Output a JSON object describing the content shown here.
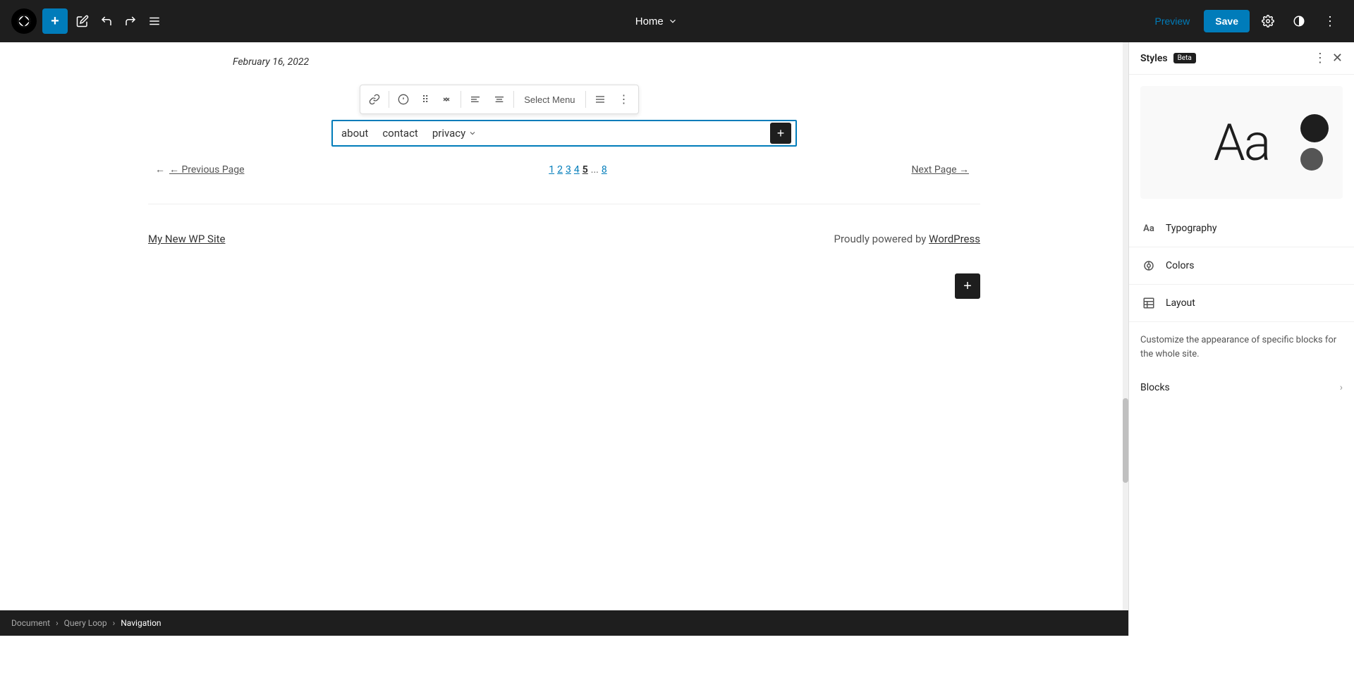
{
  "toolbar": {
    "add_label": "+",
    "undo_label": "↺",
    "redo_label": "↻",
    "menu_label": "≡",
    "home_label": "Home",
    "preview_label": "Preview",
    "save_label": "Save",
    "settings_icon": "⚙",
    "style_icon": "◑",
    "more_icon": "⋮"
  },
  "page": {
    "date": "February 16, 2022"
  },
  "nav_block": {
    "items": [
      {
        "label": "about"
      },
      {
        "label": "contact"
      },
      {
        "label": "privacy",
        "has_submenu": true
      }
    ],
    "add_label": "+"
  },
  "block_toolbar": {
    "link_icon": "🔗",
    "info_icon": "ⓘ",
    "drag_icon": "⋮⋮",
    "up_down_icon": "⇅",
    "align_left_icon": "▐",
    "align_center_icon": "≡",
    "select_menu_label": "Select Menu",
    "text_align_icon": "≡",
    "more_icon": "⋮"
  },
  "pagination": {
    "prev_label": "← Previous Page",
    "next_label": "Next Page →",
    "pages": [
      "1",
      "2",
      "3",
      "4",
      "5",
      "...",
      "8"
    ]
  },
  "footer": {
    "site_name": "My New WP Site",
    "powered_text": "Proudly powered by ",
    "powered_link": "WordPress"
  },
  "right_panel": {
    "title": "Styles",
    "beta_label": "Beta",
    "preview_text": "Aa",
    "options": [
      {
        "id": "typography",
        "label": "Typography",
        "icon": "Aa"
      },
      {
        "id": "colors",
        "label": "Colors",
        "icon": "◎"
      },
      {
        "id": "layout",
        "label": "Layout",
        "icon": "▦"
      }
    ],
    "description": "Customize the appearance of specific blocks for the whole site.",
    "blocks_label": "Blocks"
  },
  "breadcrumb": {
    "items": [
      {
        "label": "Document",
        "is_link": true
      },
      {
        "label": "Query Loop",
        "is_link": true
      },
      {
        "label": "Navigation",
        "is_link": false
      }
    ]
  }
}
